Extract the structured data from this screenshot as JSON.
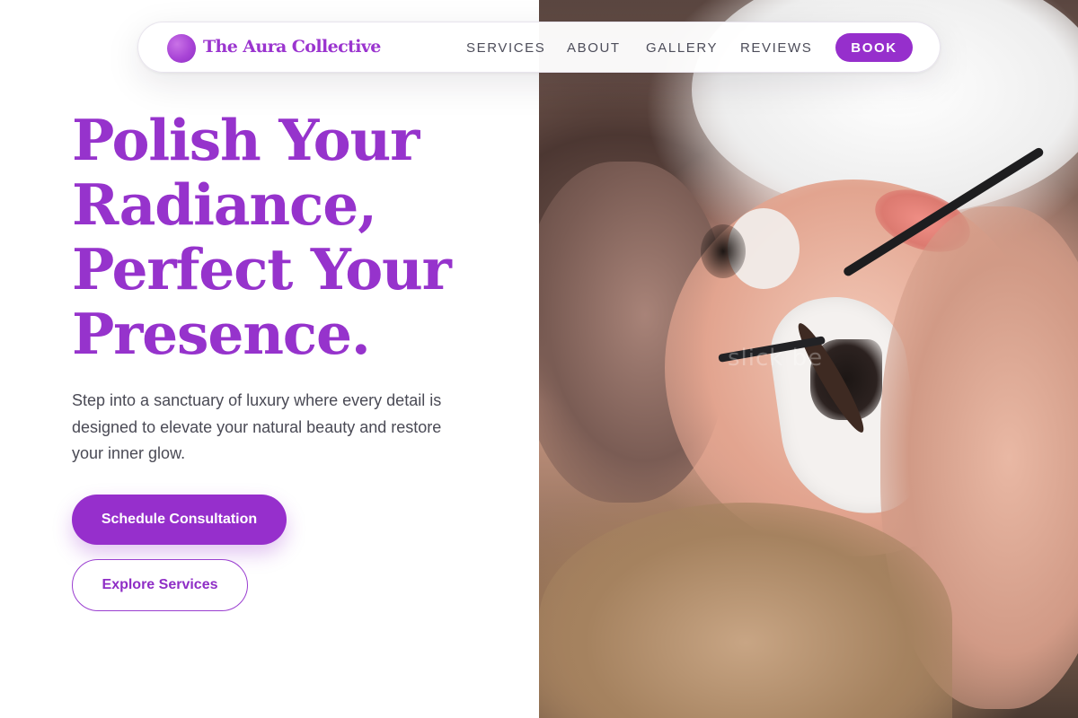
{
  "brand": {
    "name": "The Aura Collective",
    "accent_color": "#962fcc"
  },
  "nav": {
    "items": [
      {
        "label": "SERVICES"
      },
      {
        "label": "ABOUT"
      },
      {
        "label": "GALLERY"
      },
      {
        "label": "REVIEWS"
      }
    ],
    "cta_label": "BOOK"
  },
  "hero": {
    "title_lines": [
      "Polish Your",
      "Radiance,",
      "Perfect Your",
      "Presence."
    ],
    "description": "Step into a sanctuary of luxury where every detail is designed to elevate your natural beauty and restore your inner glow.",
    "primary_button": "Schedule Consultation",
    "secondary_button": "Explore Services"
  },
  "image": {
    "watermark_text": "slick be"
  }
}
